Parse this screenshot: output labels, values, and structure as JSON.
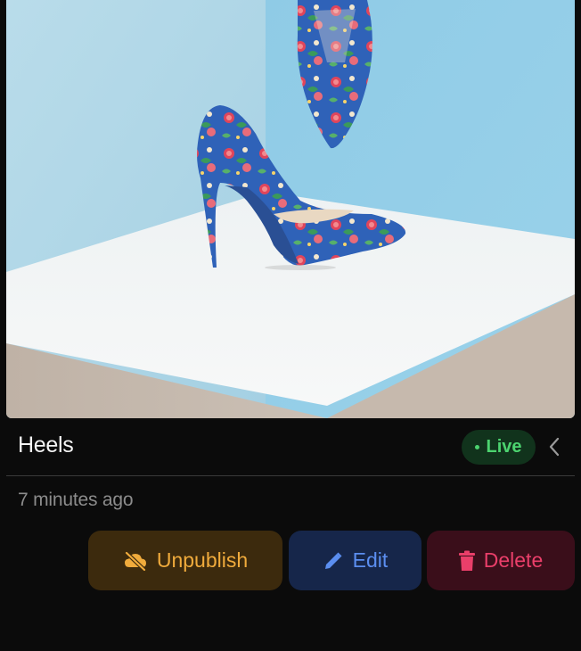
{
  "product": {
    "title": "Heels",
    "status": "Live",
    "timestamp": "7 minutes ago",
    "image_subject": "floral-stiletto-heels-photo"
  },
  "actions": {
    "unpublish_label": "Unpublish",
    "edit_label": "Edit",
    "delete_label": "Delete"
  },
  "icons": {
    "collapse": "chevron-left-icon",
    "unpublish": "cloud-off-icon",
    "edit": "pencil-icon",
    "delete": "trash-icon"
  },
  "colors": {
    "status_live": "#4cd36f",
    "unpublish": "#f0ab3c",
    "edit": "#5b8ef0",
    "delete": "#ea3f6a"
  }
}
